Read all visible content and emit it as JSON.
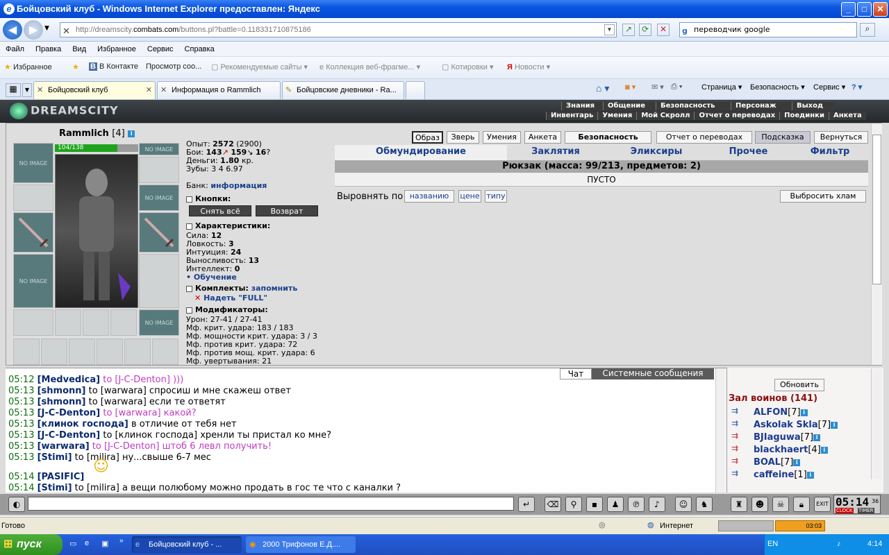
{
  "window": {
    "title": "Бойцовский клуб - Windows Internet Explorer предоставлен: Яндекс"
  },
  "nav": {
    "address_prefix": "http://dreamscity.",
    "address_host": "combats.com",
    "address_path": "/buttons.pl?battle=0.118331710875186",
    "search": "переводчик google"
  },
  "menu": [
    "Файл",
    "Правка",
    "Вид",
    "Избранное",
    "Сервис",
    "Справка"
  ],
  "favbar": {
    "favorites": "Избранное",
    "links": [
      "В Контакте",
      "Просмотр соо...",
      "Рекомендуемые сайты ▾",
      "Коллекция веб-фрагме... ▾",
      "Котировки ▾",
      "Новости ▾"
    ]
  },
  "tabs": [
    "Бойцовский клуб",
    "Информация о Rammlich",
    "Бойцовские дневники - Ra..."
  ],
  "toolbar_right": [
    "Страница ▾",
    "Безопасность ▾",
    "Сервис ▾"
  ],
  "game": {
    "logo": "DREAMSCITY",
    "topnav1": [
      "Знания",
      "Общение",
      "Безопасность",
      "Персонаж",
      "Выход"
    ],
    "topnav2": [
      "Инвентарь",
      "Умения",
      "Мой Скролл",
      "Отчет о переводах",
      "Поединки",
      "Анкета"
    ],
    "char": {
      "name": "Rammlich",
      "level": "[4]",
      "hp": "104/138",
      "hp_fraction": 0.754
    },
    "slot_label": "NO IMAGE",
    "stats": {
      "exp_label": "Опыт:",
      "exp": "2572",
      "exp_next": "(2900)",
      "fights_label": "Бои:",
      "wins": "143",
      "losses": "159",
      "draws": "16",
      "money_label": "Деньги:",
      "money": "1.80",
      "money_unit": "кр.",
      "teeth_label": "Зубы:",
      "teeth": "3 4 6.97",
      "bank_label": "Банк:",
      "bank_link": "информация"
    },
    "buttons_section": "Кнопки:",
    "remove_all": "Снять всё",
    "return": "Возврат",
    "chars_section": "Характеристики:",
    "attrs": [
      {
        "k": "Сила:",
        "v": "12"
      },
      {
        "k": "Ловкость:",
        "v": "3"
      },
      {
        "k": "Интуиция:",
        "v": "24"
      },
      {
        "k": "Выносливость:",
        "v": "13"
      },
      {
        "k": "Интеллект:",
        "v": "0"
      }
    ],
    "training": "• Обучение",
    "sets_section": "Комплекты:",
    "remember": "запомнить",
    "wear_full": "Надеть \"FULL\"",
    "mods_section": "Модификаторы:",
    "mods": [
      "Урон: 27-41 / 27-41",
      "Мф. крит. удара: 183 / 183",
      "Мф. мощности крит. удара: 3 / 3",
      "Мф. против крит. удара: 72",
      "Мф. против мощ. крит. удара: 6",
      "Мф. увертывания: 21"
    ],
    "top_buttons": [
      "Образ",
      "Зверь",
      "Умения",
      "Анкета",
      "Безопасность",
      "Отчет о переводах",
      "Подсказка",
      "Вернуться"
    ],
    "inv_tabs": [
      "Обмундирование",
      "Заклятия",
      "Эликсиры",
      "Прочее",
      "Фильтр"
    ],
    "backpack": "Рюкзак (масса: 99/213, предметов: 2)",
    "empty": "ПУСТО",
    "sort_label": "Выровнять по",
    "sort_options": [
      "названию",
      "цене",
      "типу"
    ],
    "junk": "Выбросить хлам"
  },
  "chat": {
    "tabs": [
      "Чат",
      "Системные сообщения"
    ],
    "lines": [
      {
        "time": "05:12",
        "nick": "Medvedica",
        "to": "to [J-C-Denton]",
        "msg": ")))",
        "private": true
      },
      {
        "time": "05:13",
        "nick": "shmonn",
        "to": "to [warwara]",
        "msg": "спросиш и мне скажеш ответ",
        "private": false
      },
      {
        "time": "05:13",
        "nick": "shmonn",
        "to": "to [warwara]",
        "msg": "если те ответят",
        "private": false
      },
      {
        "time": "05:13",
        "nick": "J-C-Denton",
        "to": "to [warwara]",
        "msg": "какой?",
        "private": true
      },
      {
        "time": "05:13",
        "nick": "клинок господа",
        "to": "",
        "msg": "в отличие от тебя нет",
        "private": false
      },
      {
        "time": "05:13",
        "nick": "J-C-Denton",
        "to": "to [клинок господа]",
        "msg": "хренли ты пристал ко мне?",
        "private": false
      },
      {
        "time": "05:13",
        "nick": "warwara",
        "to": "to [J-C-Denton]",
        "msg": "штоб 6 левл получить!",
        "private": true
      },
      {
        "time": "05:13",
        "nick": "Stimi",
        "to": "to [milira]",
        "msg": "ну...свыше 6-7 мес",
        "private": false
      },
      {
        "time": "05:14",
        "nick": "PASIFIC",
        "to": "",
        "msg": "",
        "private": false
      },
      {
        "time": "05:14",
        "nick": "Stimi",
        "to": "to [milira]",
        "msg": "а вещи полюбому можно продать в гос те что с каналки ?",
        "private": false
      }
    ]
  },
  "room": {
    "refresh": "Обновить",
    "title": "Зал воинов (141)",
    "users": [
      {
        "n": "ALFON",
        "l": "[7]"
      },
      {
        "n": "Askolak Skla",
        "l": "[7]"
      },
      {
        "n": "BJIaguwa",
        "l": "[7]"
      },
      {
        "n": "blackhaert",
        "l": "[4]"
      },
      {
        "n": "BOAL",
        "l": "[7]"
      },
      {
        "n": "caffeine",
        "l": "[1]"
      }
    ]
  },
  "clock": {
    "time": "05:14",
    "sec": "36",
    "clock_label": "CLOCK",
    "timer_label": "TIMER",
    "exit": "EXIT"
  },
  "status": {
    "ready": "Готово",
    "zone": "Интернет",
    "media_time": "03:03"
  },
  "taskbar": {
    "start": "пуск",
    "tasks": [
      "Бойцовский клуб - ...",
      "2000 Трифонов Е.Д...."
    ],
    "lang": "EN",
    "time": "4:14"
  }
}
